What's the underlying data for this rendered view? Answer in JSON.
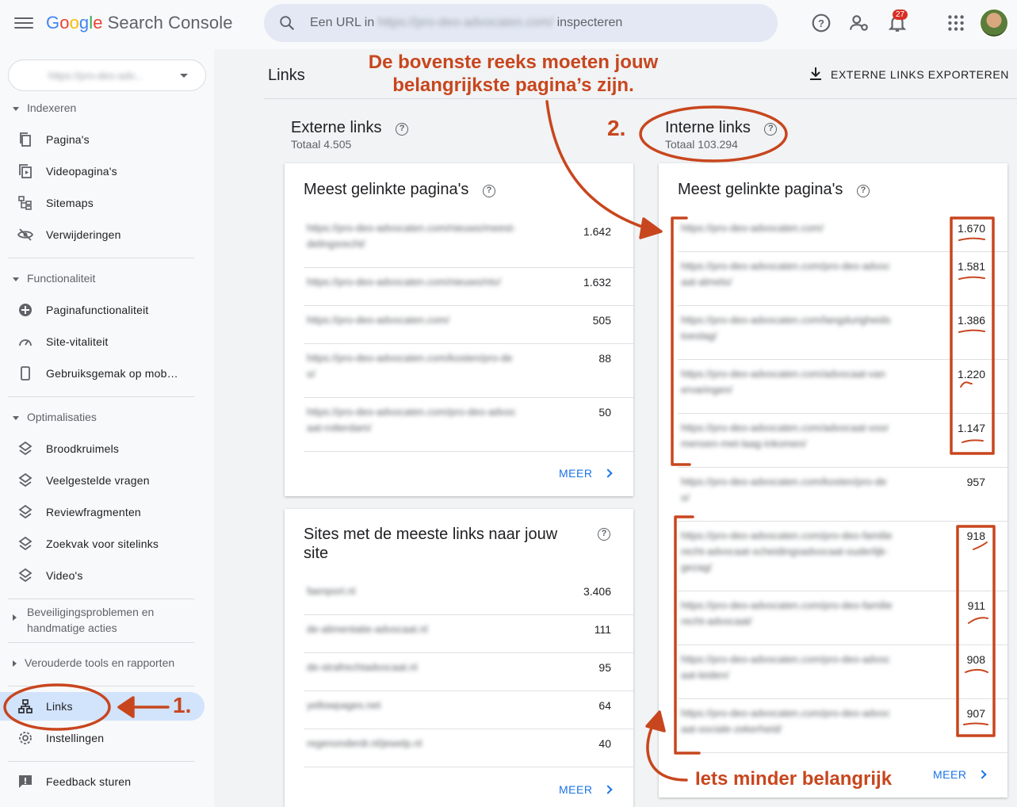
{
  "app": {
    "logo_google": [
      "G",
      "o",
      "o",
      "g",
      "l",
      "e"
    ],
    "logo_product": "Search Console"
  },
  "search": {
    "prefix": "Een URL in",
    "blurred_url": "https://pro-deo-advocaten.com/",
    "suffix": "inspecteren"
  },
  "notifications": {
    "count": "27"
  },
  "property": {
    "value": "https://pro-deo-adv..."
  },
  "sidebar": {
    "indexeren": {
      "heading": "Indexeren",
      "items": [
        "Pagina's",
        "Videopagina's",
        "Sitemaps",
        "Verwijderingen"
      ]
    },
    "functionaliteit": {
      "heading": "Functionaliteit",
      "items": [
        "Paginafunctionaliteit",
        "Site-vitaliteit",
        "Gebruiksgemak op mob…"
      ]
    },
    "optimalisaties": {
      "heading": "Optimalisaties",
      "items": [
        "Broodkruimels",
        "Veelgestelde vragen",
        "Reviewfragmenten",
        "Zoekvak voor sitelinks",
        "Video's"
      ]
    },
    "security": {
      "heading_line1": "Beveiligingsproblemen en",
      "heading_line2": "handmatige acties"
    },
    "legacy": {
      "heading": "Verouderde tools en rapporten"
    },
    "links": "Links",
    "settings": "Instellingen",
    "feedback": "Feedback sturen"
  },
  "main": {
    "title": "Links",
    "export_label": "EXTERNE LINKS EXPORTEREN",
    "external": {
      "title": "Externe links",
      "total": "Totaal 4.505",
      "top_pages": {
        "title": "Meest gelinkte pagina's",
        "rows": [
          {
            "url1": "https://pro-deo-advocaten.com/nieuws/meest-",
            "url2": "delingsrecht/",
            "value": "1.642"
          },
          {
            "url1": "https://pro-deo-advocaten.com/nieuws/ntv/",
            "url2": "",
            "value": "1.632"
          },
          {
            "url1": "https://pro-deo-advocaten.com/",
            "url2": "",
            "value": "505"
          },
          {
            "url1": "https://pro-deo-advocaten.com/kosten/pro-de",
            "url2": "o/",
            "value": "88"
          },
          {
            "url1": "https://pro-deo-advocaten.com/pro-deo-advoc",
            "url2": "aat-rotterdam/",
            "value": "50"
          }
        ],
        "more": "MEER"
      },
      "top_sites": {
        "title": "Sites met de meeste links naar jouw site",
        "rows": [
          {
            "url1": "faenport.nl",
            "value": "3.406"
          },
          {
            "url1": "de-alimentatie-advocaat.nl",
            "value": "111"
          },
          {
            "url1": "de-strafrechtadvocaat.nl",
            "value": "95"
          },
          {
            "url1": "yellowpages.net",
            "value": "64"
          },
          {
            "url1": "regenonderdr.nl/jewelp.nl",
            "value": "40"
          }
        ],
        "more": "MEER"
      }
    },
    "internal": {
      "title": "Interne links",
      "total": "Totaal 103.294",
      "top_pages": {
        "title": "Meest gelinkte pagina's",
        "rows": [
          {
            "url1": "https://pro-deo-advocaten.com/",
            "url2": "",
            "value": "1.670"
          },
          {
            "url1": "https://pro-deo-advocaten.com/pro-deo-advoc",
            "url2": "aat-almelo/",
            "value": "1.581"
          },
          {
            "url1": "https://pro-deo-advocaten.com/langdurigheids",
            "url2": "toeslag/",
            "value": "1.386"
          },
          {
            "url1": "https://pro-deo-advocaten.com/advocaat-van",
            "url2": "ervaringen/",
            "value": "1.220"
          },
          {
            "url1": "https://pro-deo-advocaten.com/advocaat-voor",
            "url2": "mensen-met-laag-inkomen/",
            "value": "1.147"
          },
          {
            "url1": "https://pro-deo-advocaten.com/kosten/pro-de",
            "url2": "o/",
            "value": "957"
          },
          {
            "url1": "https://pro-deo-advocaten.com/pro-deo-familie",
            "url2": "recht-advocaat-scheidingsadvocaat-ouderlijk-",
            "url3": "gezag/",
            "value": "918"
          },
          {
            "url1": "https://pro-deo-advocaten.com/pro-deo-familie",
            "url2": "recht-advocaat/",
            "value": "911"
          },
          {
            "url1": "https://pro-deo-advocaten.com/pro-deo-advoc",
            "url2": "aat-leiden/",
            "value": "908"
          },
          {
            "url1": "https://pro-deo-advocaten.com/pro-deo-advoc",
            "url2": "aat-sociale-zekerheid/",
            "value": "907"
          }
        ],
        "more": "MEER"
      }
    }
  },
  "annotations": {
    "top_line1": "De bovenste reeks moeten jouw",
    "top_line2": "belangrijkste pagina’s zijn.",
    "step1": "1.",
    "step2": "2.",
    "bottom": "Iets minder belangrijk",
    "color": "#c8461e"
  }
}
